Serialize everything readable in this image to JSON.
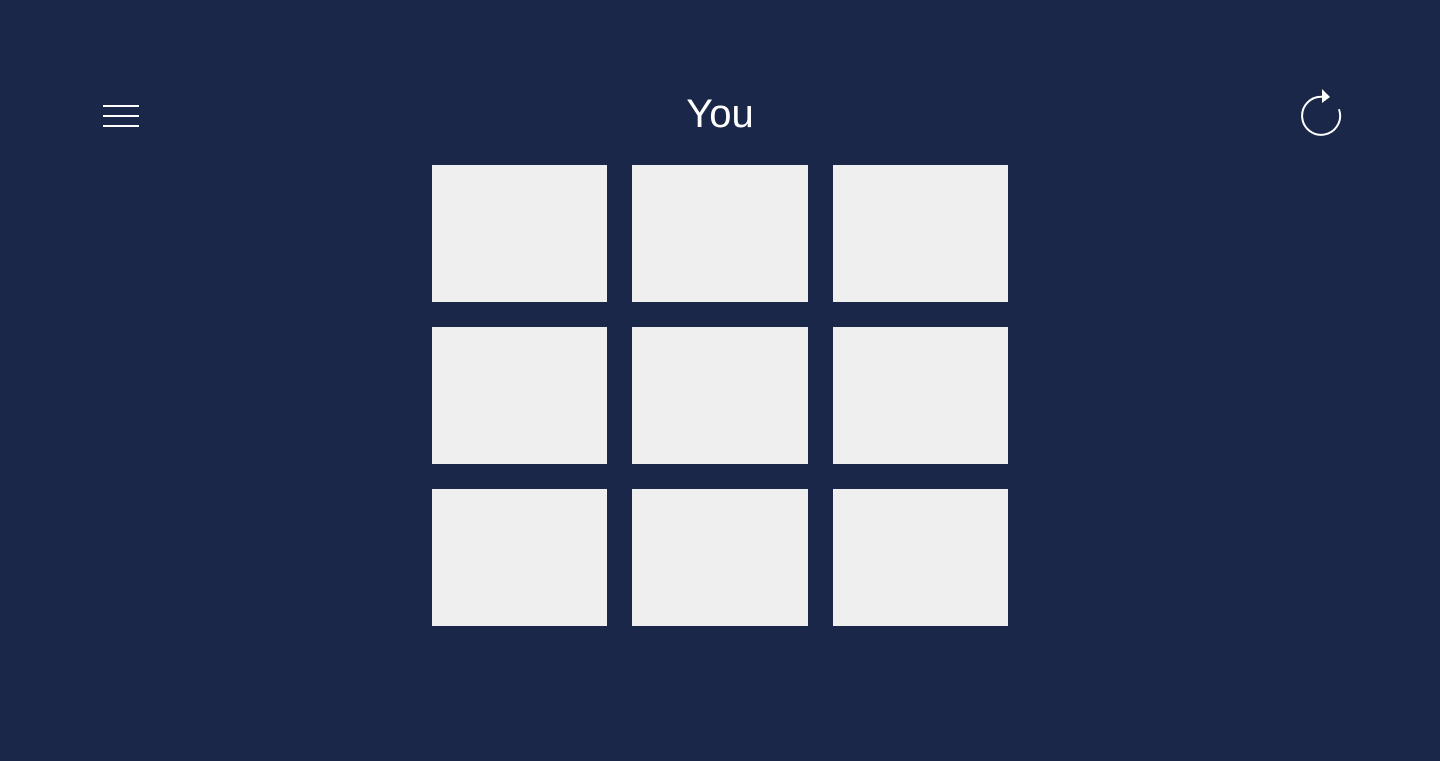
{
  "header": {
    "turn_label": "You"
  },
  "icons": {
    "menu": "hamburger-menu-icon",
    "restart": "restart-icon"
  },
  "colors": {
    "background": "#1a2749",
    "cell": "#efefef",
    "text": "#ffffff"
  },
  "board": {
    "cells": [
      "",
      "",
      "",
      "",
      "",
      "",
      "",
      "",
      ""
    ]
  }
}
